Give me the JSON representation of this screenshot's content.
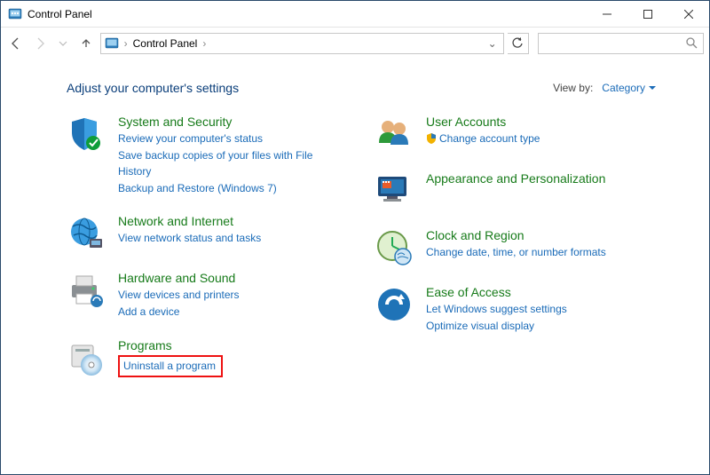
{
  "window": {
    "title": "Control Panel"
  },
  "addressbar": {
    "crumb1": "Control Panel"
  },
  "header": {
    "title": "Adjust your computer's settings",
    "viewby_label": "View by:",
    "viewby_value": "Category"
  },
  "cats": {
    "system": {
      "title": "System and Security",
      "l1": "Review your computer's status",
      "l2": "Save backup copies of your files with File History",
      "l3": "Backup and Restore (Windows 7)"
    },
    "network": {
      "title": "Network and Internet",
      "l1": "View network status and tasks"
    },
    "hardware": {
      "title": "Hardware and Sound",
      "l1": "View devices and printers",
      "l2": "Add a device"
    },
    "programs": {
      "title": "Programs",
      "l1": "Uninstall a program"
    },
    "users": {
      "title": "User Accounts",
      "l1": "Change account type"
    },
    "appearance": {
      "title": "Appearance and Personalization"
    },
    "clock": {
      "title": "Clock and Region",
      "l1": "Change date, time, or number formats"
    },
    "ease": {
      "title": "Ease of Access",
      "l1": "Let Windows suggest settings",
      "l2": "Optimize visual display"
    }
  }
}
